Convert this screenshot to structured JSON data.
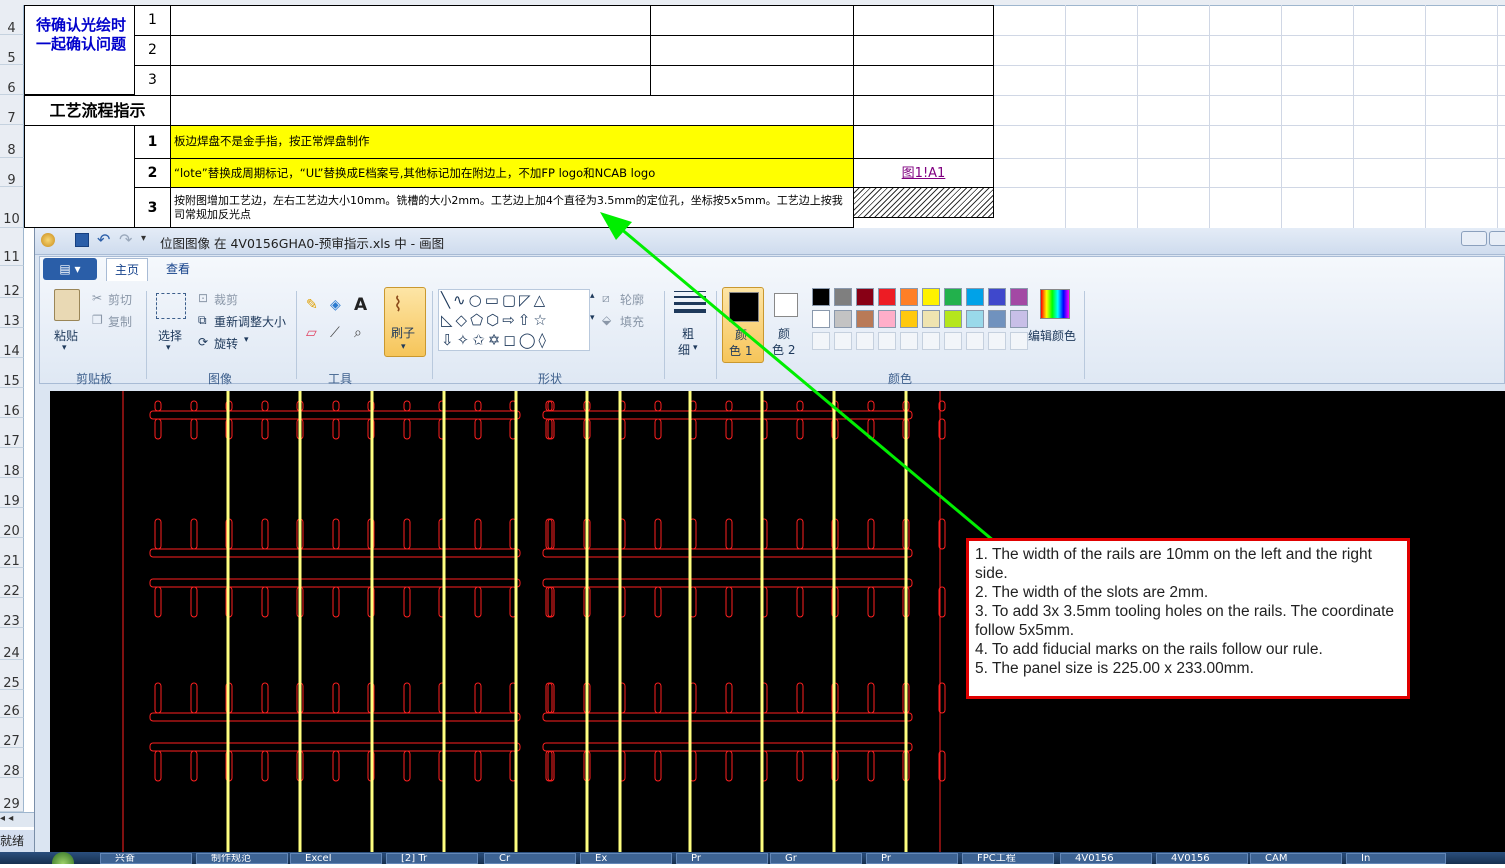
{
  "sheet": {
    "rows": [
      "4",
      "5",
      "6",
      "7",
      "8",
      "9",
      "10",
      "11",
      "12",
      "13",
      "14",
      "15",
      "16",
      "17",
      "18",
      "19",
      "20",
      "21",
      "22",
      "23",
      "24",
      "25",
      "26",
      "27",
      "28",
      "29"
    ],
    "pending_label_line1": "待确认光绘时",
    "pending_label_line2": "一起确认问题",
    "pending_numbers": [
      "1",
      "2",
      "3"
    ],
    "process_label": "工艺流程指示",
    "process_rows": [
      {
        "num": "1",
        "text": "板边焊盘不是金手指，按正常焊盘制作"
      },
      {
        "num": "2",
        "text": "“lote”替换成周期标记，“UL”替换成E档案号,其他标记加在附边上，不加FP logo和NCAB logo"
      },
      {
        "num": "3",
        "text": "按附图增加工艺边，左右工艺边大小10mm。铣槽的大小2mm。工艺边上加4个直径为3.5mm的定位孔，坐标按5x5mm。工艺边上按我司常规加反光点"
      }
    ],
    "link_text": "图1!A1",
    "status_text": "就绪",
    "colors": {
      "yellow": "#ffff00",
      "link": "#800080",
      "label_blue": "#0000cc"
    }
  },
  "paint": {
    "title": "位图图像 在 4V0156GHA0-预审指示.xls 中 - 画图",
    "menu_button": "▤ ▾",
    "tabs": [
      "主页",
      "查看"
    ],
    "clipboard": {
      "paste": "粘贴",
      "cut": "剪切",
      "copy": "复制",
      "group": "剪贴板"
    },
    "image": {
      "select": "选择",
      "crop": "裁剪",
      "resize": "重新调整大小",
      "rotate": "旋转",
      "group": "图像"
    },
    "tools": {
      "group": "工具"
    },
    "brush": "刷子",
    "shapes": {
      "outline": "轮廓",
      "fill": "填充",
      "group": "形状"
    },
    "size_line1": "粗",
    "size_line2": "细",
    "color1_line1": "颜",
    "color1_line2": "色 1",
    "color2_line1": "颜",
    "color2_line2": "色 2",
    "edit_colors": "编辑颜色",
    "colors_group": "颜色",
    "palette_row1": [
      "#000000",
      "#7f7f7f",
      "#880015",
      "#ed1c24",
      "#ff7f27",
      "#fff200",
      "#22b14c",
      "#00a2e8",
      "#3f48cc",
      "#a349a4"
    ],
    "palette_row2": [
      "#ffffff",
      "#c3c3c3",
      "#b97a57",
      "#ffaec9",
      "#ffc90e",
      "#efe4b0",
      "#b5e61d",
      "#99d9ea",
      "#7092be",
      "#c8bfe7"
    ],
    "note_lines": [
      "1. The width of the rails are 10mm on the left and the right side.",
      "2. The width of the slots are 2mm.",
      "3. To add 3x 3.5mm tooling holes on the rails. The coordinate follow 5x5mm.",
      "4. To add fiducial marks on the rails follow our rule.",
      "5. The panel size is 225.00 x 233.00mm."
    ],
    "board_colors": {
      "outline": "#ff2020",
      "rail": "#ffff80",
      "background": "#000000"
    },
    "arrow_color": "#00ee00"
  },
  "taskbar": {
    "items": [
      "兴奋",
      "制作规范",
      "Excel",
      "[2] Tr",
      "Cr",
      "Ex",
      "Pr",
      "Gr",
      "Pr",
      "FPC工程",
      "4V0156",
      "4V0156",
      "CAM",
      "In"
    ]
  }
}
